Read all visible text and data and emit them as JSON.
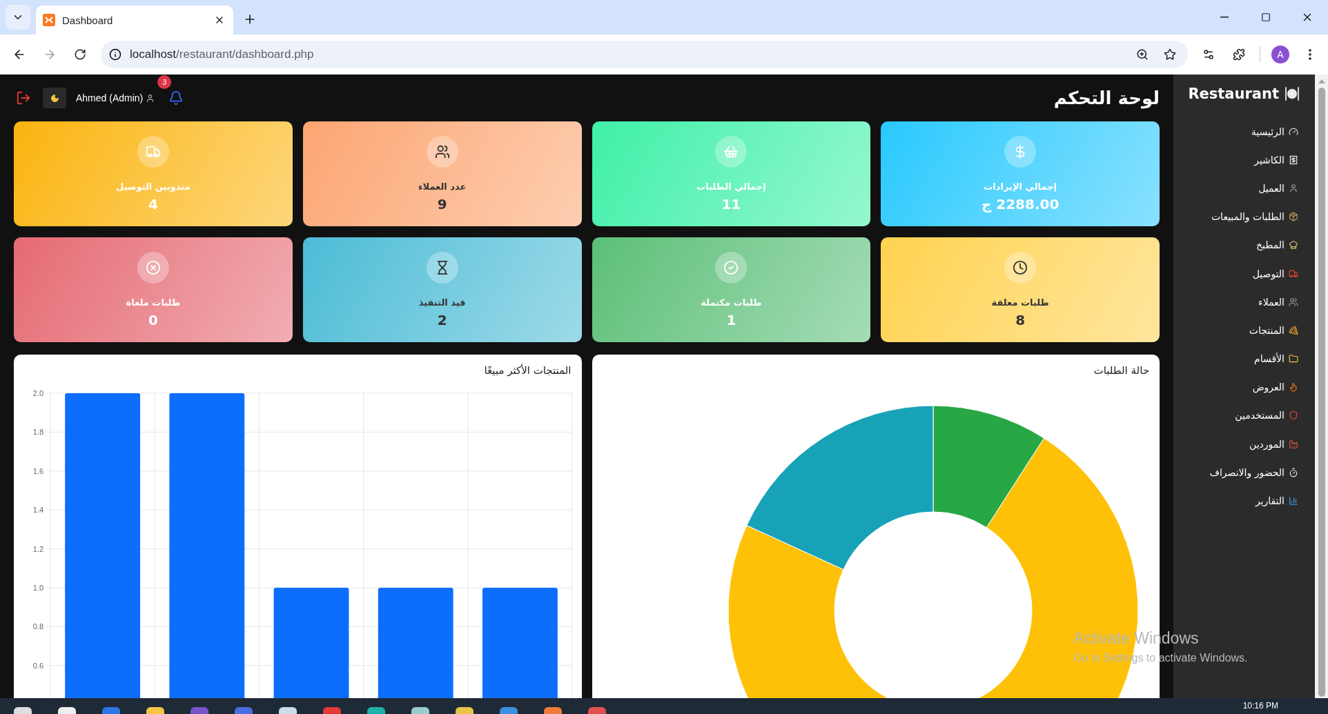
{
  "browser": {
    "tab_title": "Dashboard",
    "url_host": "localhost",
    "url_path": "/restaurant/dashboard.php",
    "profile_initial": "A"
  },
  "header": {
    "title": "لوحة التحكم",
    "user": "Ahmed (Admin)",
    "notifications": "3"
  },
  "stats": [
    {
      "label": "إجمالي الإيرادات",
      "value": "2288.00 ج",
      "color": "#29c9fe"
    },
    {
      "label": "إجمالي الطلبات",
      "value": "11",
      "color": "#3ff0a8"
    },
    {
      "label": "عدد العملاء",
      "value": "9",
      "color": "#fca572"
    },
    {
      "label": "مندوبين التوصيل",
      "value": "4",
      "color": "#fbb40f"
    },
    {
      "label": "طلبات معلقة",
      "value": "8",
      "color": "#ffd24f"
    },
    {
      "label": "طلبات مكتملة",
      "value": "1",
      "color": "#5cbf78"
    },
    {
      "label": "قيد التنفيذ",
      "value": "2",
      "color": "#4cbcd6"
    },
    {
      "label": "طلبات ملغاة",
      "value": "0",
      "color": "#e56a73"
    }
  ],
  "status_chart": {
    "title": "حالة الطلبات"
  },
  "products_chart": {
    "title": "المنتجات الأكثر مبيعًا",
    "chart_data": {
      "type": "bar",
      "grid": true,
      "ylim": [
        0,
        2
      ],
      "yticks": [
        {
          "value": 0.6,
          "label": "0.6"
        },
        {
          "value": 0.8,
          "label": "0.8"
        },
        {
          "value": 1.0,
          "label": "1.0"
        },
        {
          "value": 1.2,
          "label": "1.2"
        },
        {
          "value": 1.4,
          "label": "1.4"
        },
        {
          "value": 1.6,
          "label": "1.6"
        },
        {
          "value": 1.8,
          "label": "1.8"
        },
        {
          "value": 2.0,
          "label": "2.0"
        }
      ],
      "series": [
        {
          "color": "#0d6efd",
          "values": [
            2,
            2,
            1,
            1,
            1
          ]
        }
      ]
    }
  },
  "sidebar": {
    "brand": "Restaurant",
    "items": [
      {
        "label": "الرئيسية"
      },
      {
        "label": "الكاشير"
      },
      {
        "label": "العميل"
      },
      {
        "label": "الطلبات والمبيعات"
      },
      {
        "label": "المطبخ"
      },
      {
        "label": "التوصيل"
      },
      {
        "label": "العملاء"
      },
      {
        "label": "المنتجات"
      },
      {
        "label": "الأقسام"
      },
      {
        "label": "العروض"
      },
      {
        "label": "المستخدمين"
      },
      {
        "label": "الموردين"
      },
      {
        "label": "الحضور والانصراف"
      },
      {
        "label": "التقارير"
      }
    ]
  },
  "os_notice": {
    "title": "Activate Windows",
    "text": "Go to Settings to activate Windows."
  },
  "taskbar": {
    "time": "10:16 PM"
  }
}
